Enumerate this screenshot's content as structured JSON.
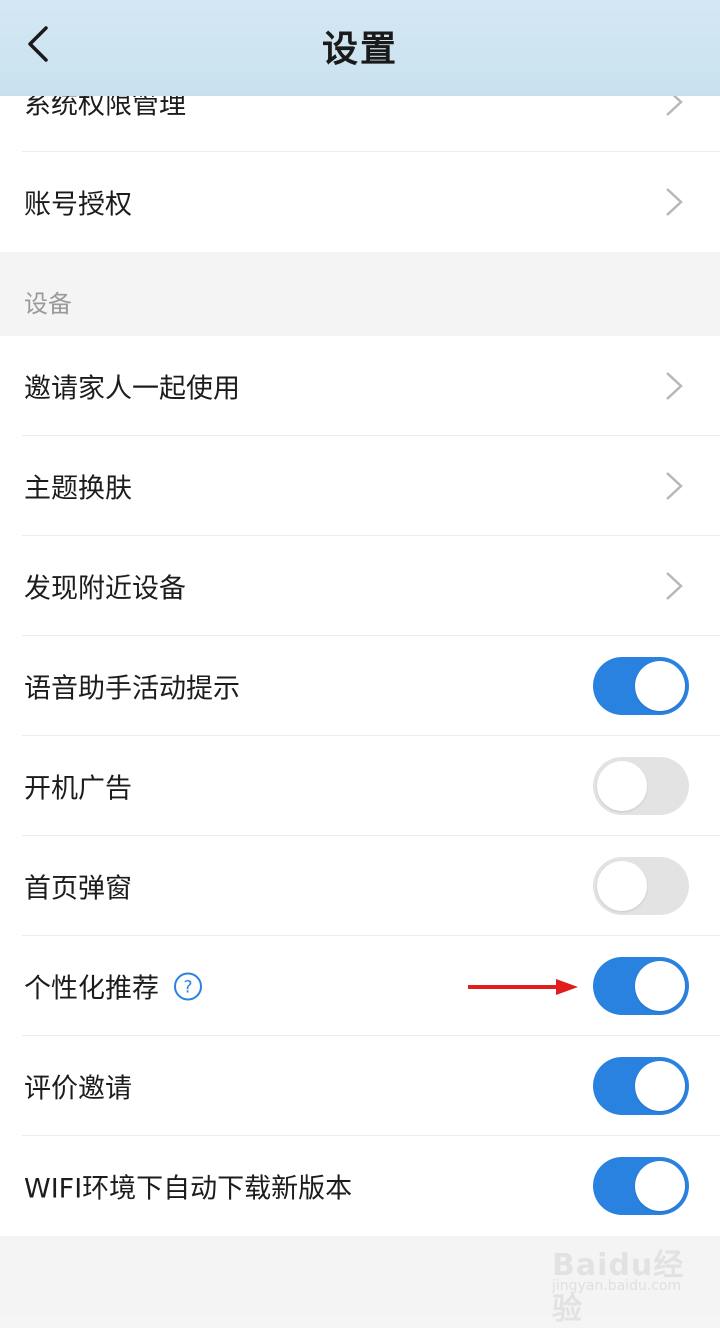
{
  "header": {
    "title": "设置"
  },
  "rows_top": [
    {
      "label": "系统权限管理",
      "type": "link"
    },
    {
      "label": "账号授权",
      "type": "link"
    }
  ],
  "section_device": {
    "title": "设备",
    "rows": [
      {
        "label": "邀请家人一起使用",
        "type": "link"
      },
      {
        "label": "主题换肤",
        "type": "link"
      },
      {
        "label": "发现附近设备",
        "type": "link"
      },
      {
        "label": "语音助手活动提示",
        "type": "toggle",
        "on": true
      },
      {
        "label": "开机广告",
        "type": "toggle",
        "on": false
      },
      {
        "label": "首页弹窗",
        "type": "toggle",
        "on": false
      },
      {
        "label": "个性化推荐",
        "type": "toggle",
        "on": true,
        "help": "?"
      },
      {
        "label": "评价邀请",
        "type": "toggle",
        "on": true
      },
      {
        "label": "WIFI环境下自动下载新版本",
        "type": "toggle",
        "on": true
      }
    ]
  },
  "watermark": {
    "text": "Baidu经验",
    "sub": "jingyan.baidu.com"
  },
  "colors": {
    "header_bg": "#c9e1ef",
    "toggle_on": "#2a82e0",
    "toggle_off": "#e3e3e3",
    "annotation_arrow": "#e11d1d",
    "help_icon": "#2a82e0"
  },
  "icons": [
    "back-arrow-icon",
    "chevron-right-icon",
    "question-circle-icon",
    "red-arrow-annotation"
  ]
}
